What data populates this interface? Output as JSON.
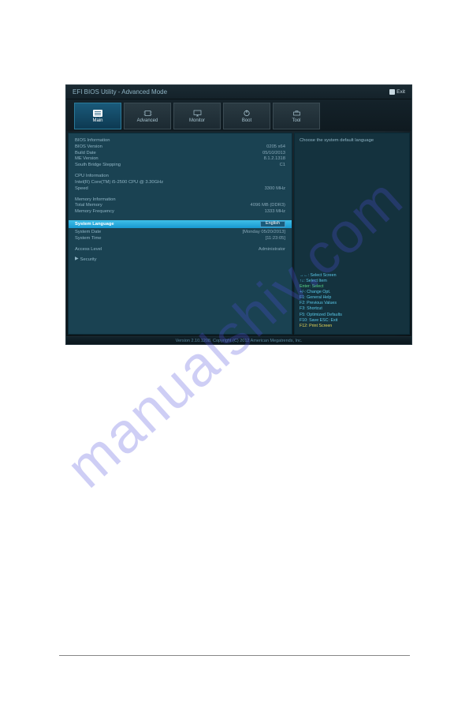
{
  "watermark": "manualshiv.com",
  "titlebar": {
    "title": "EFI BIOS Utility - Advanced Mode",
    "exit_label": "Exit"
  },
  "tabs": [
    {
      "label": "Main",
      "icon": "list-icon"
    },
    {
      "label": "Advanced",
      "icon": "chip-icon"
    },
    {
      "label": "Monitor",
      "icon": "monitor-icon"
    },
    {
      "label": "Boot",
      "icon": "power-icon"
    },
    {
      "label": "Tool",
      "icon": "tool-icon"
    }
  ],
  "bios_info": {
    "header": "BIOS Information",
    "version_label": "BIOS Version",
    "version_value": "0205 x64",
    "build_label": "Build Date",
    "build_value": "05/10/2013",
    "me_label": "ME Version",
    "me_value": "8.1.2.1318",
    "sb_label": "South Bridge Stepping",
    "sb_value": "C1"
  },
  "cpu_info": {
    "header": "CPU Information",
    "name": "Intel(R) Core(TM) i5-2500 CPU @ 3.30GHz",
    "speed_label": "Speed",
    "speed_value": "3300 MHz"
  },
  "mem_info": {
    "header": "Memory Information",
    "total_label": "Total Memory",
    "total_value": "4096 MB (DDR3)",
    "freq_label": "Memory Frequency",
    "freq_value": "1333 MHz"
  },
  "lang": {
    "label": "System Language",
    "value": "English"
  },
  "datetime": {
    "date_label": "System Date",
    "date_value": "[Monday 05/20/2013]",
    "time_label": "System Time",
    "time_value": "[11:23:05]"
  },
  "access": {
    "label": "Access Level",
    "value": "Administrator"
  },
  "security": {
    "label": "Security"
  },
  "help": {
    "description": "Choose the system default language",
    "keys": [
      {
        "class": "key-cyan",
        "text": "→←: Select Screen"
      },
      {
        "class": "key-cyan",
        "text": "↑↓: Select Item"
      },
      {
        "class": "key-green",
        "text": "Enter: Select"
      },
      {
        "class": "key-cyan",
        "text": "+/-: Change Opt."
      },
      {
        "class": "key-cyan",
        "text": "F1: General Help"
      },
      {
        "class": "key-cyan",
        "text": "F2: Previous Values"
      },
      {
        "class": "key-cyan",
        "text": "F3: Shortcut"
      },
      {
        "class": "key-cyan",
        "text": "F5: Optimized Defaults"
      },
      {
        "class": "key-cyan",
        "text": "F10: Save  ESC: Exit"
      },
      {
        "class": "key-yellow",
        "text": "F12: Print Screen"
      }
    ]
  },
  "footer": "Version 2.10.1208. Copyright (C) 2012 American Megatrends, Inc."
}
